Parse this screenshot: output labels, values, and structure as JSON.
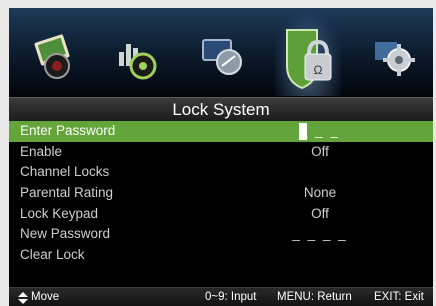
{
  "menu_tabs": [
    {
      "name": "picture",
      "icon": "picture-icon",
      "selected": false
    },
    {
      "name": "sound",
      "icon": "sound-icon",
      "selected": false
    },
    {
      "name": "channel",
      "icon": "channel-icon",
      "selected": false
    },
    {
      "name": "lock",
      "icon": "lock-icon",
      "selected": true
    },
    {
      "name": "setup",
      "icon": "gear-icon",
      "selected": false
    }
  ],
  "title": "Lock System",
  "items": [
    {
      "label": "Enter Password",
      "value": "_ _ _"
    },
    {
      "label": "Enable",
      "value": "Off"
    },
    {
      "label": "Channel Locks",
      "value": ""
    },
    {
      "label": "Parental Rating",
      "value": "None"
    },
    {
      "label": "Lock Keypad",
      "value": "Off"
    },
    {
      "label": "New Password",
      "value": "_ _ _ _"
    },
    {
      "label": "Clear Lock",
      "value": ""
    }
  ],
  "footer": {
    "move": "Move",
    "input": "0~9: Input",
    "menu": "MENU: Return",
    "exit": "EXIT: Exit"
  },
  "colors": {
    "highlight": "#63a43b",
    "background": "#000000",
    "text": "#cfcfcf"
  }
}
